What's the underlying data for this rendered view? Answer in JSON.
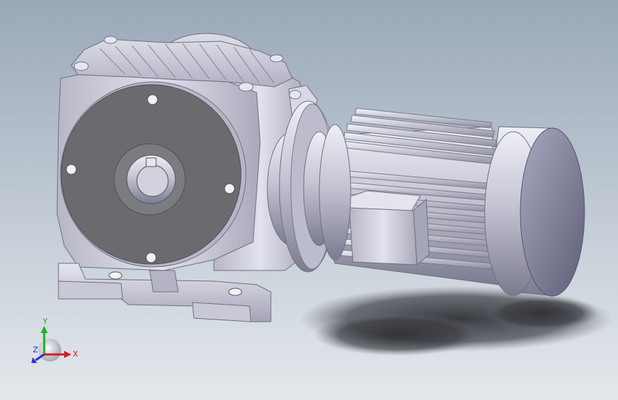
{
  "viewport": {
    "background_top": "#9aa8b8",
    "background_bottom": "#e4e8ec"
  },
  "model": {
    "body_color": "#c9c9d9",
    "shadow_color": "#3a3c42",
    "flange_color": "#6b6b6f"
  },
  "triad": {
    "x_label": "X",
    "y_label": "Y",
    "z_label": "Z",
    "x_color": "#d11f1f",
    "y_color": "#1fae2c",
    "z_color": "#2431d6"
  }
}
